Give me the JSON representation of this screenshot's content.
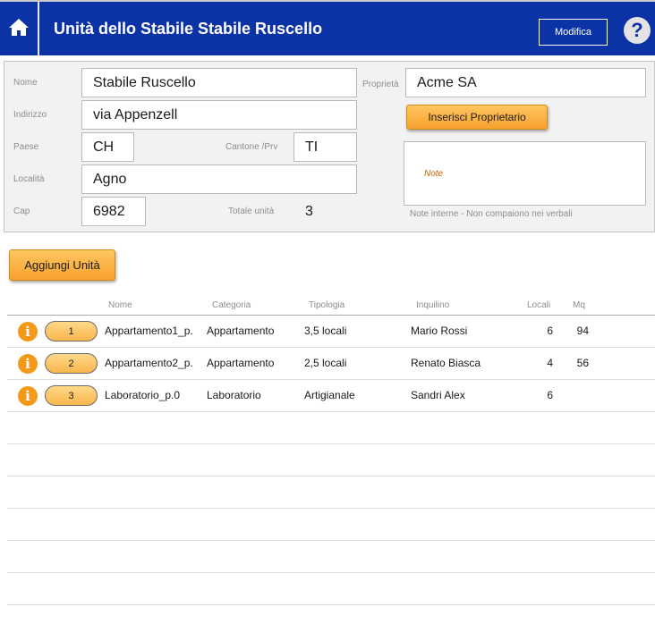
{
  "header": {
    "title": "Unità dello Stabile Stabile Ruscello",
    "edit_label": "Modifica",
    "help_glyph": "?",
    "icons": [
      "home-icon",
      "help-icon"
    ],
    "color": "#0c33a6"
  },
  "form": {
    "nome_label": "Nome",
    "nome_value": "Stabile Ruscello",
    "indirizzo_label": "Indirizzo",
    "indirizzo_value": "via Appenzell",
    "paese_label": "Paese",
    "paese_value": "CH",
    "cantone_label": "Cantone /Prv",
    "cantone_value": "TI",
    "localita_label": "Località",
    "localita_value": "Agno",
    "cap_label": "Cap",
    "cap_value": "6982",
    "totale_label": "Totale unità",
    "totale_value": "3",
    "proprieta_label": "Proprietà",
    "proprieta_value": "Acme SA",
    "insert_owner_label": "Inserisci Proprietario",
    "note_label": "Note",
    "note_hint": "Note interne - Non compaiono nei verbali"
  },
  "actions": {
    "add_unit_label": "Aggiungi Unità"
  },
  "table": {
    "columns": [
      "Nome",
      "Categoria",
      "Tipologia",
      "Inquilino",
      "Locali",
      "Mq"
    ],
    "info_glyph": "i",
    "rows": [
      {
        "num": "1",
        "nome": "Appartamento1_p.",
        "categoria": "Appartamento",
        "tipologia": "3,5 locali",
        "inquilino": "Mario Rossi",
        "locali": "6",
        "mq": "94"
      },
      {
        "num": "2",
        "nome": "Appartamento2_p.",
        "categoria": "Appartamento",
        "tipologia": "2,5 locali",
        "inquilino": "Renato Biasca",
        "locali": "4",
        "mq": "56"
      },
      {
        "num": "3",
        "nome": "Laboratorio_p.0",
        "categoria": "Laboratorio",
        "tipologia": "Artigianale",
        "inquilino": "Sandri Alex",
        "locali": "6",
        "mq": ""
      }
    ]
  },
  "colors": {
    "accent_orange": "#f7a12e",
    "info_orange": "#f49a1a"
  }
}
